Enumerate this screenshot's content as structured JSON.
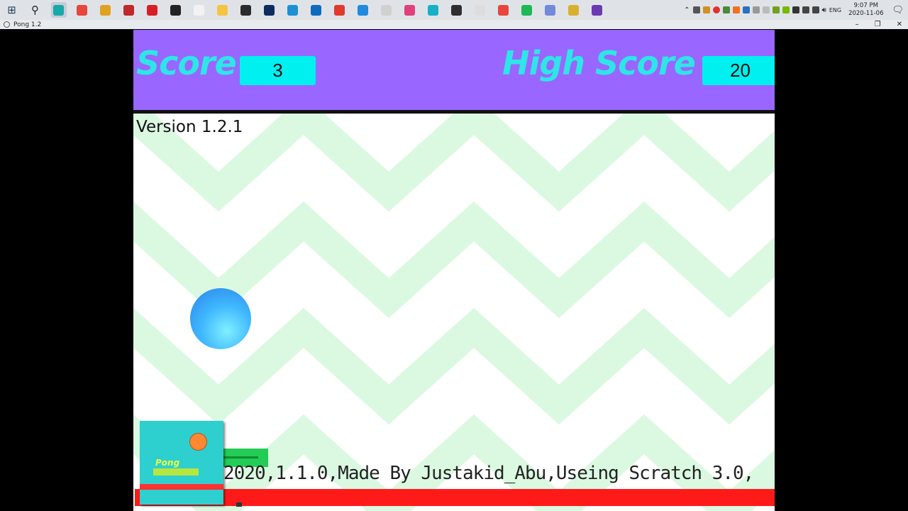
{
  "taskbar": {
    "clock_time": "9:07 PM",
    "clock_date": "2020-11-06",
    "language": "ENG",
    "pinned_icons": [
      {
        "name": "app-icon",
        "color": "#17a8a8"
      },
      {
        "name": "chrome-icon",
        "color": "#e8453c"
      },
      {
        "name": "app-icon",
        "color": "#e0a020"
      },
      {
        "name": "among-us-icon",
        "color": "#c0282b"
      },
      {
        "name": "netflix-icon",
        "color": "#d81f26"
      },
      {
        "name": "terminal-icon",
        "color": "#222222"
      },
      {
        "name": "file-icon",
        "color": "#f2f2f2"
      },
      {
        "name": "file-explorer-icon",
        "color": "#f5c342"
      },
      {
        "name": "store-icon",
        "color": "#2b2b2b"
      },
      {
        "name": "photoshop-icon",
        "color": "#0c2d5e"
      },
      {
        "name": "edge-icon",
        "color": "#1e8fd6"
      },
      {
        "name": "mail-icon",
        "color": "#0f6cbd"
      },
      {
        "name": "roblox-icon",
        "color": "#e23a2b"
      },
      {
        "name": "app-icon",
        "color": "#1f8ae0"
      },
      {
        "name": "paint-icon",
        "color": "#d0d0d0"
      },
      {
        "name": "app-icon",
        "color": "#e0407a"
      },
      {
        "name": "app-icon",
        "color": "#18b0c8"
      },
      {
        "name": "obs-icon",
        "color": "#302e31"
      },
      {
        "name": "unity-icon",
        "color": "#dddddd"
      },
      {
        "name": "chrome-icon",
        "color": "#e8453c"
      },
      {
        "name": "spotify-icon",
        "color": "#1db954"
      },
      {
        "name": "discord-icon",
        "color": "#7289da"
      },
      {
        "name": "rh-icon",
        "color": "#d8b030"
      },
      {
        "name": "app-icon",
        "color": "#6a3ab0"
      }
    ]
  },
  "window": {
    "title": "Pong 1.2",
    "minimize": "–",
    "restore": "❐",
    "close": "✕"
  },
  "game": {
    "score_label": "Score",
    "score_value": "3",
    "high_score_label": "High Score",
    "high_score_value": "20",
    "version": "Version 1.2.1",
    "credit": "2020,1.1.0,Made By Justakid_Abu,Useing Scratch 3.0,",
    "thumbnail_title": "Pong"
  },
  "colors": {
    "header": "#9966ff",
    "score_text": "#2ee6e6",
    "score_box": "#00f0f0",
    "zigzag": "#dbf9e1",
    "floor": "#ff1a1a"
  }
}
